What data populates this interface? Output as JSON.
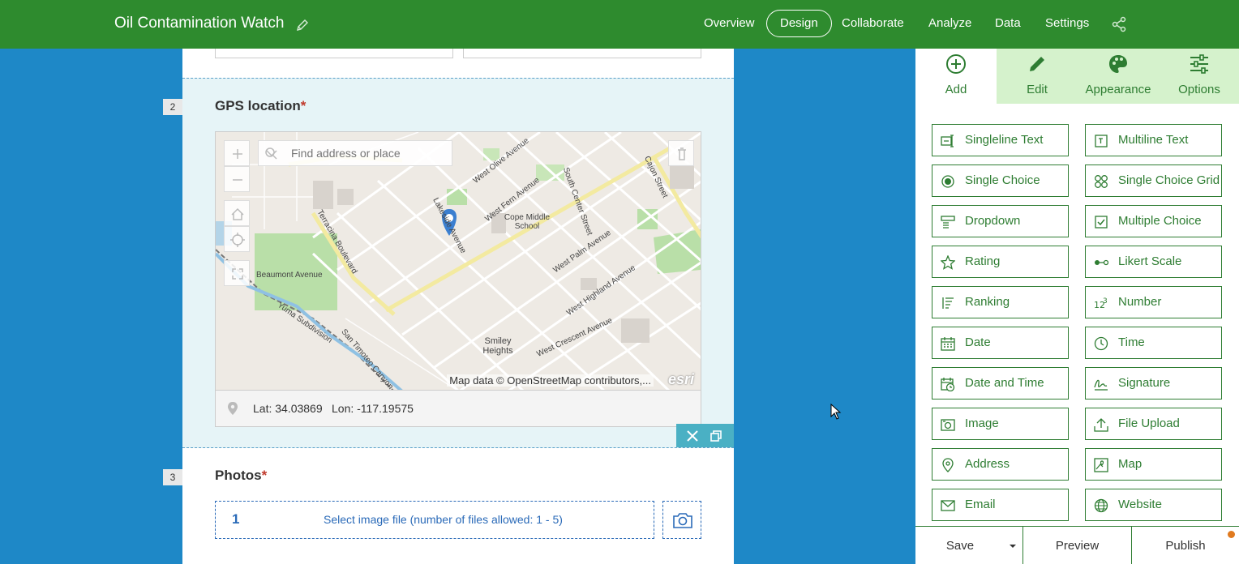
{
  "header": {
    "title": "Oil Contamination Watch",
    "nav": [
      {
        "label": "Overview",
        "active": false
      },
      {
        "label": "Design",
        "active": true
      },
      {
        "label": "Collaborate",
        "active": false
      },
      {
        "label": "Analyze",
        "active": false
      },
      {
        "label": "Data",
        "active": false
      },
      {
        "label": "Settings",
        "active": false
      }
    ],
    "brand_color": "#2e8b2e"
  },
  "form": {
    "questions": [
      {
        "number": "2",
        "title": "GPS location",
        "required_mark": "*",
        "map": {
          "search_placeholder": "Find address or place",
          "attribution": "Map data © OpenStreetMap contributors,...",
          "logo_text": "esri",
          "labels": [
            "West Olive Avenue",
            "West Fern Avenue",
            "South Center Street",
            "Cajon Street",
            "Cope Middle School",
            "Lakeside Avenue",
            "Terracina Boulevard",
            "West Palm Avenue",
            "Beaumont Avenue",
            "West Highland Avenue",
            "Yuma Subdivision",
            "San Timoteo Canyon",
            "Smiley Heights",
            "West Crescent Avenue"
          ]
        },
        "lat_label": "Lat: 34.03869",
        "lon_label": "Lon: -117.19575"
      },
      {
        "number": "3",
        "title": "Photos",
        "required_mark": "*",
        "file_count": "1",
        "file_prompt": "Select image file (number of files allowed: 1 - 5)"
      }
    ]
  },
  "panel": {
    "tabs": [
      {
        "label": "Add",
        "icon": "plus-circle-icon",
        "active": true
      },
      {
        "label": "Edit",
        "icon": "pencil-icon",
        "active": false
      },
      {
        "label": "Appearance",
        "icon": "palette-icon",
        "active": false
      },
      {
        "label": "Options",
        "icon": "sliders-icon",
        "active": false
      }
    ],
    "question_types": [
      {
        "label": "Singleline Text",
        "icon": "singleline-text-icon"
      },
      {
        "label": "Multiline Text",
        "icon": "multiline-text-icon"
      },
      {
        "label": "Single Choice",
        "icon": "radio-icon"
      },
      {
        "label": "Single Choice Grid",
        "icon": "grid-icon"
      },
      {
        "label": "Dropdown",
        "icon": "dropdown-icon"
      },
      {
        "label": "Multiple Choice",
        "icon": "checkbox-icon"
      },
      {
        "label": "Rating",
        "icon": "star-icon"
      },
      {
        "label": "Likert Scale",
        "icon": "likert-icon"
      },
      {
        "label": "Ranking",
        "icon": "ranking-icon"
      },
      {
        "label": "Number",
        "icon": "number-icon"
      },
      {
        "label": "Date",
        "icon": "calendar-icon"
      },
      {
        "label": "Time",
        "icon": "clock-icon"
      },
      {
        "label": "Date and Time",
        "icon": "calendar-clock-icon"
      },
      {
        "label": "Signature",
        "icon": "signature-icon"
      },
      {
        "label": "Image",
        "icon": "image-icon"
      },
      {
        "label": "File Upload",
        "icon": "upload-icon"
      },
      {
        "label": "Address",
        "icon": "pin-icon"
      },
      {
        "label": "Map",
        "icon": "map-icon"
      },
      {
        "label": "Email",
        "icon": "envelope-icon"
      },
      {
        "label": "Website",
        "icon": "globe-icon"
      }
    ],
    "footer": {
      "save": "Save",
      "preview": "Preview",
      "publish": "Publish"
    },
    "accent_color": "#2e7d32"
  }
}
